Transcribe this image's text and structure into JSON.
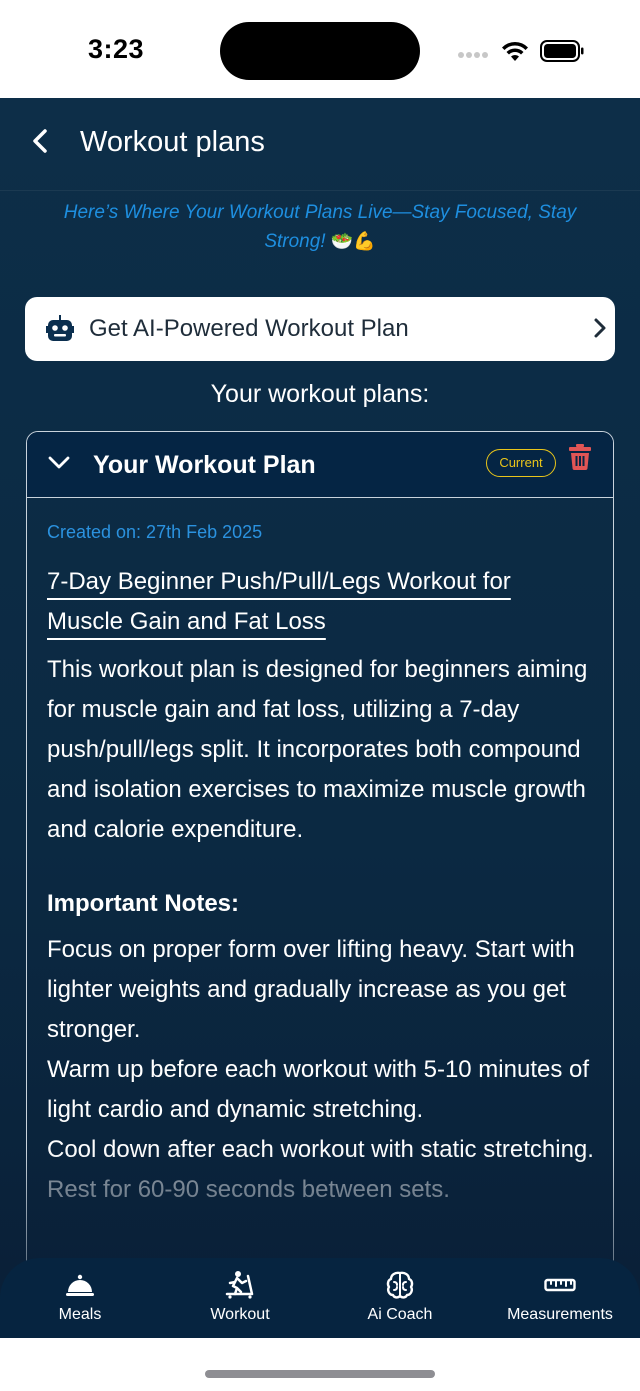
{
  "status_bar": {
    "time": "3:23"
  },
  "header": {
    "title": "Workout plans",
    "back_icon": "chevron-left-icon"
  },
  "tagline": {
    "text": "Here’s Where Your Workout Plans Live—Stay Focused, Stay Strong!",
    "emoji": "🥗💪"
  },
  "ai_button": {
    "label": "Get AI-Powered Workout Plan",
    "icon": "robot-icon"
  },
  "plans_heading": "Your workout plans:",
  "plan": {
    "title": "Your Workout Plan",
    "badge": "Current",
    "created": "Created on: 27th Feb 2025",
    "name": "7-Day Beginner Push/Pull/Legs Workout for Muscle Gain and Fat Loss",
    "description": "This workout plan is designed for beginners aiming for muscle gain and fat loss, utilizing a 7-day push/pull/legs split. It incorporates both compound and isolation exercises to maximize muscle growth and calorie expenditure.",
    "notes_title": "Important Notes:",
    "notes": [
      "Focus on proper form over lifting heavy. Start with lighter weights and gradually increase as you get stronger.",
      "Warm up before each workout with 5-10 minutes of light cardio and dynamic stretching.",
      "Cool down after each workout with static stretching.",
      "Rest for 60-90 seconds between sets."
    ]
  },
  "tabs": [
    {
      "label": "Meals",
      "icon": "cloche-icon"
    },
    {
      "label": "Workout",
      "icon": "treadmill-icon"
    },
    {
      "label": "Ai Coach",
      "icon": "brain-icon"
    },
    {
      "label": "Measurements",
      "icon": "ruler-icon"
    }
  ],
  "colors": {
    "background": "#0b2942",
    "accent_blue": "#1e8fe0",
    "badge_yellow": "#e9c51a",
    "delete_red": "#e05555"
  }
}
